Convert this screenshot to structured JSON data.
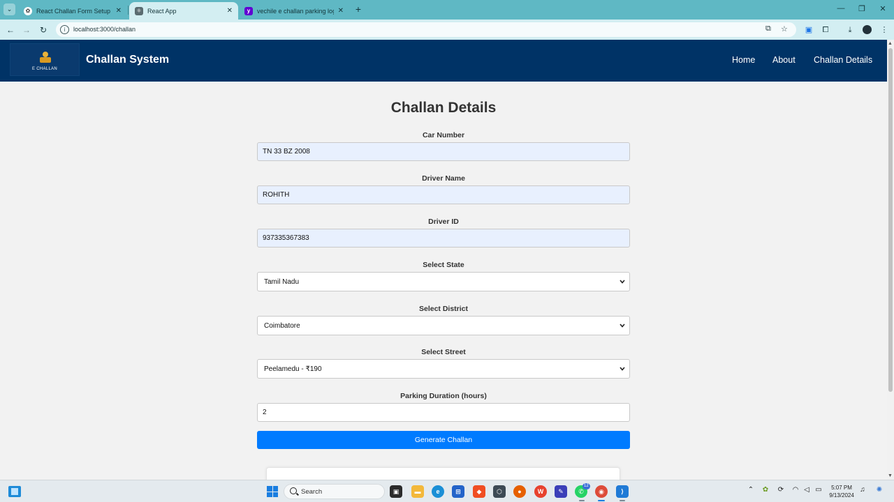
{
  "browser": {
    "tabs": [
      {
        "title": "React Challan Form Setup",
        "active": false,
        "favicon": "openai-icon"
      },
      {
        "title": "React App",
        "active": true,
        "favicon": "react-icon"
      },
      {
        "title": "vechile e challan parking logo -",
        "active": false,
        "favicon": "yahoo-icon"
      }
    ],
    "url": "localhost:3000/challan",
    "new_tab_label": "+"
  },
  "header": {
    "logo_text": "E CHALLAN",
    "brand": "Challan System",
    "nav": [
      "Home",
      "About",
      "Challan Details"
    ],
    "background": "#003366"
  },
  "form": {
    "title": "Challan Details",
    "car_number": {
      "label": "Car Number",
      "value": "TN 33 BZ 2008"
    },
    "driver_name": {
      "label": "Driver Name",
      "value": "ROHITH"
    },
    "driver_id": {
      "label": "Driver ID",
      "value": "937335367383"
    },
    "state": {
      "label": "Select State",
      "value": "Tamil Nadu"
    },
    "district": {
      "label": "Select District",
      "value": "Coimbatore"
    },
    "street": {
      "label": "Select Street",
      "value": "Peelamedu - ₹190"
    },
    "duration": {
      "label": "Parking Duration (hours)",
      "value": "2"
    },
    "submit_label": "Generate Challan",
    "accent": "#007bff"
  },
  "taskbar": {
    "search_placeholder": "Search",
    "whatsapp_badge": "12",
    "time": "5:07 PM",
    "date": "9/13/2024"
  }
}
